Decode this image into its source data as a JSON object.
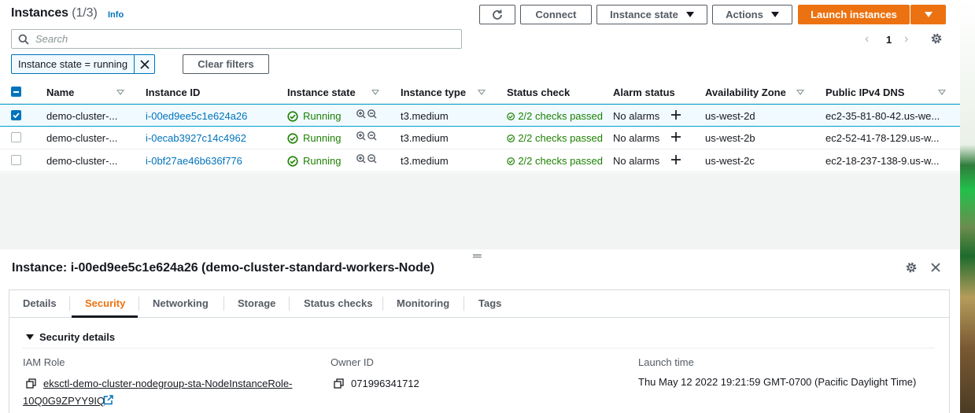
{
  "header": {
    "title": "Instances",
    "count": "(1/3)",
    "info": "Info",
    "connect_label": "Connect",
    "instance_state_label": "Instance state",
    "actions_label": "Actions",
    "launch_label": "Launch instances"
  },
  "search": {
    "placeholder": "Search"
  },
  "pagination": {
    "current_page": "1"
  },
  "filter": {
    "token": "Instance state = running",
    "clear_label": "Clear filters"
  },
  "table": {
    "columns": [
      "Name",
      "Instance ID",
      "Instance state",
      "Instance type",
      "Status check",
      "Alarm status",
      "Availability Zone",
      "Public IPv4 DNS"
    ],
    "rows": [
      {
        "selected": true,
        "name": "demo-cluster-...",
        "id": "i-00ed9ee5c1e624a26",
        "state": "Running",
        "type": "t3.medium",
        "status": "2/2 checks passed",
        "alarm": "No alarms",
        "az": "us-west-2d",
        "dns": "ec2-35-81-80-42.us-we..."
      },
      {
        "selected": false,
        "name": "demo-cluster-...",
        "id": "i-0ecab3927c14c4962",
        "state": "Running",
        "type": "t3.medium",
        "status": "2/2 checks passed",
        "alarm": "No alarms",
        "az": "us-west-2b",
        "dns": "ec2-52-41-78-129.us-w..."
      },
      {
        "selected": false,
        "name": "demo-cluster-...",
        "id": "i-0bf27ae46b636f776",
        "state": "Running",
        "type": "t3.medium",
        "status": "2/2 checks passed",
        "alarm": "No alarms",
        "az": "us-west-2c",
        "dns": "ec2-18-237-138-9.us-w..."
      }
    ]
  },
  "details": {
    "title": "Instance: i-00ed9ee5c1e624a26 (demo-cluster-standard-workers-Node)",
    "tabs": [
      "Details",
      "Security",
      "Networking",
      "Storage",
      "Status checks",
      "Monitoring",
      "Tags"
    ],
    "active_tab": "Security",
    "section_title": "Security details",
    "iam_role_label": "IAM Role",
    "iam_role_value_line1": "eksctl-demo-cluster-nodegroup-sta-NodeInstanceRole-",
    "iam_role_value_line2": "10Q0G9ZPYY9IQ",
    "owner_id_label": "Owner ID",
    "owner_id_value": "071996341712",
    "launch_time_label": "Launch time",
    "launch_time_value": "Thu May 12 2022 19:21:59 GMT-0700 (Pacific Daylight Time)"
  },
  "colors": {
    "accent_orange": "#ec7211",
    "link_blue": "#0073bb",
    "success_green": "#1d8102",
    "selected_row_bg": "#f1faff"
  }
}
